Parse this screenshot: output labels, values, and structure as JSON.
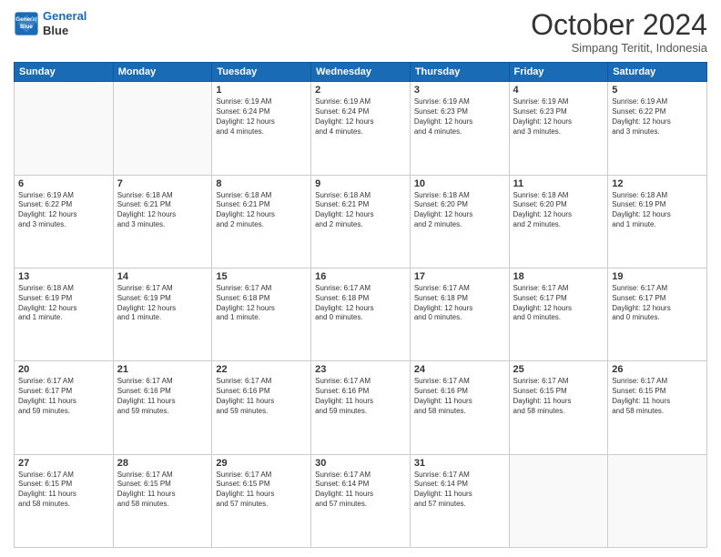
{
  "logo": {
    "line1": "General",
    "line2": "Blue"
  },
  "header": {
    "month": "October 2024",
    "location": "Simpang Teritit, Indonesia"
  },
  "weekdays": [
    "Sunday",
    "Monday",
    "Tuesday",
    "Wednesday",
    "Thursday",
    "Friday",
    "Saturday"
  ],
  "weeks": [
    [
      {
        "day": "",
        "info": ""
      },
      {
        "day": "",
        "info": ""
      },
      {
        "day": "1",
        "info": "Sunrise: 6:19 AM\nSunset: 6:24 PM\nDaylight: 12 hours\nand 4 minutes."
      },
      {
        "day": "2",
        "info": "Sunrise: 6:19 AM\nSunset: 6:24 PM\nDaylight: 12 hours\nand 4 minutes."
      },
      {
        "day": "3",
        "info": "Sunrise: 6:19 AM\nSunset: 6:23 PM\nDaylight: 12 hours\nand 4 minutes."
      },
      {
        "day": "4",
        "info": "Sunrise: 6:19 AM\nSunset: 6:23 PM\nDaylight: 12 hours\nand 3 minutes."
      },
      {
        "day": "5",
        "info": "Sunrise: 6:19 AM\nSunset: 6:22 PM\nDaylight: 12 hours\nand 3 minutes."
      }
    ],
    [
      {
        "day": "6",
        "info": "Sunrise: 6:19 AM\nSunset: 6:22 PM\nDaylight: 12 hours\nand 3 minutes."
      },
      {
        "day": "7",
        "info": "Sunrise: 6:18 AM\nSunset: 6:21 PM\nDaylight: 12 hours\nand 3 minutes."
      },
      {
        "day": "8",
        "info": "Sunrise: 6:18 AM\nSunset: 6:21 PM\nDaylight: 12 hours\nand 2 minutes."
      },
      {
        "day": "9",
        "info": "Sunrise: 6:18 AM\nSunset: 6:21 PM\nDaylight: 12 hours\nand 2 minutes."
      },
      {
        "day": "10",
        "info": "Sunrise: 6:18 AM\nSunset: 6:20 PM\nDaylight: 12 hours\nand 2 minutes."
      },
      {
        "day": "11",
        "info": "Sunrise: 6:18 AM\nSunset: 6:20 PM\nDaylight: 12 hours\nand 2 minutes."
      },
      {
        "day": "12",
        "info": "Sunrise: 6:18 AM\nSunset: 6:19 PM\nDaylight: 12 hours\nand 1 minute."
      }
    ],
    [
      {
        "day": "13",
        "info": "Sunrise: 6:18 AM\nSunset: 6:19 PM\nDaylight: 12 hours\nand 1 minute."
      },
      {
        "day": "14",
        "info": "Sunrise: 6:17 AM\nSunset: 6:19 PM\nDaylight: 12 hours\nand 1 minute."
      },
      {
        "day": "15",
        "info": "Sunrise: 6:17 AM\nSunset: 6:18 PM\nDaylight: 12 hours\nand 1 minute."
      },
      {
        "day": "16",
        "info": "Sunrise: 6:17 AM\nSunset: 6:18 PM\nDaylight: 12 hours\nand 0 minutes."
      },
      {
        "day": "17",
        "info": "Sunrise: 6:17 AM\nSunset: 6:18 PM\nDaylight: 12 hours\nand 0 minutes."
      },
      {
        "day": "18",
        "info": "Sunrise: 6:17 AM\nSunset: 6:17 PM\nDaylight: 12 hours\nand 0 minutes."
      },
      {
        "day": "19",
        "info": "Sunrise: 6:17 AM\nSunset: 6:17 PM\nDaylight: 12 hours\nand 0 minutes."
      }
    ],
    [
      {
        "day": "20",
        "info": "Sunrise: 6:17 AM\nSunset: 6:17 PM\nDaylight: 11 hours\nand 59 minutes."
      },
      {
        "day": "21",
        "info": "Sunrise: 6:17 AM\nSunset: 6:16 PM\nDaylight: 11 hours\nand 59 minutes."
      },
      {
        "day": "22",
        "info": "Sunrise: 6:17 AM\nSunset: 6:16 PM\nDaylight: 11 hours\nand 59 minutes."
      },
      {
        "day": "23",
        "info": "Sunrise: 6:17 AM\nSunset: 6:16 PM\nDaylight: 11 hours\nand 59 minutes."
      },
      {
        "day": "24",
        "info": "Sunrise: 6:17 AM\nSunset: 6:16 PM\nDaylight: 11 hours\nand 58 minutes."
      },
      {
        "day": "25",
        "info": "Sunrise: 6:17 AM\nSunset: 6:15 PM\nDaylight: 11 hours\nand 58 minutes."
      },
      {
        "day": "26",
        "info": "Sunrise: 6:17 AM\nSunset: 6:15 PM\nDaylight: 11 hours\nand 58 minutes."
      }
    ],
    [
      {
        "day": "27",
        "info": "Sunrise: 6:17 AM\nSunset: 6:15 PM\nDaylight: 11 hours\nand 58 minutes."
      },
      {
        "day": "28",
        "info": "Sunrise: 6:17 AM\nSunset: 6:15 PM\nDaylight: 11 hours\nand 58 minutes."
      },
      {
        "day": "29",
        "info": "Sunrise: 6:17 AM\nSunset: 6:15 PM\nDaylight: 11 hours\nand 57 minutes."
      },
      {
        "day": "30",
        "info": "Sunrise: 6:17 AM\nSunset: 6:14 PM\nDaylight: 11 hours\nand 57 minutes."
      },
      {
        "day": "31",
        "info": "Sunrise: 6:17 AM\nSunset: 6:14 PM\nDaylight: 11 hours\nand 57 minutes."
      },
      {
        "day": "",
        "info": ""
      },
      {
        "day": "",
        "info": ""
      }
    ]
  ]
}
